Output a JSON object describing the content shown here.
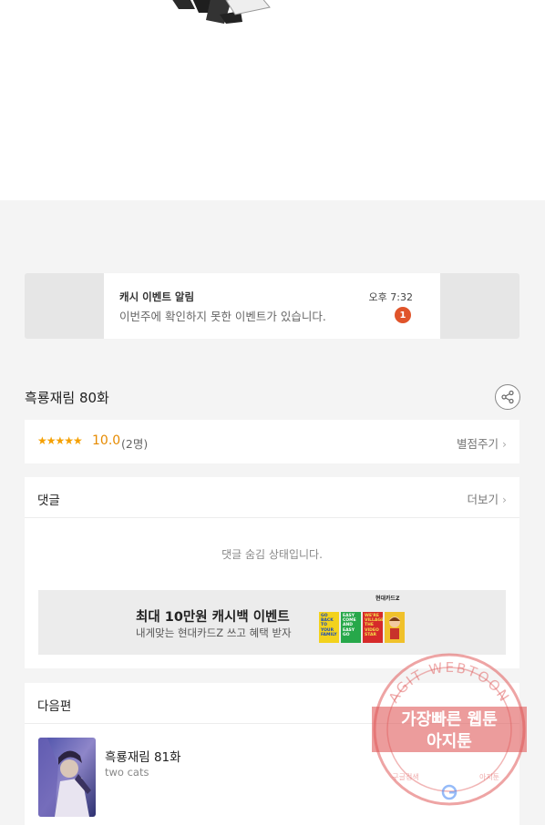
{
  "notification": {
    "title": "캐시 이벤트 알림",
    "message": "이번주에 확인하지 못한 이벤트가 있습니다.",
    "time": "오후 7:32",
    "badge": "1"
  },
  "episode": {
    "title": "흑룡재림 80화",
    "stars": "★★★★★",
    "score": "10.0",
    "votes": "(2명)",
    "rate_label": "별점주기"
  },
  "comments": {
    "header": "댓글",
    "more_label": "더보기",
    "hidden_message": "댓글 숨김 상태입니다."
  },
  "ad": {
    "title": "최대 10만원 캐시백 이벤트",
    "subtitle": "내게맞는 현대카드Z 쓰고 혜택 받자",
    "brand": "현대카드Z",
    "tiles": [
      "GO BACK TO YOUR FAMILY",
      "EASY COME AND EASY GO",
      "WE'RE VILLAGE THE VIDEO STAR",
      ""
    ]
  },
  "next_episode": {
    "header": "다음편",
    "title": "흑룡재림 81화",
    "author": "two cats"
  },
  "watermark": {
    "ring_text": "AGIT WEBTOON",
    "line1": "가장빠른 웹툰",
    "line2": "아지툰",
    "bottom_left": "구글검색",
    "bottom_right": "아지툰"
  },
  "icons": {
    "share": "share-icon",
    "chevron": "chevron-right-icon",
    "google": "google-icon"
  },
  "colors": {
    "accent_orange": "#e68a00",
    "badge_red": "#e0542a",
    "stamp_red": "#e05a5a"
  }
}
